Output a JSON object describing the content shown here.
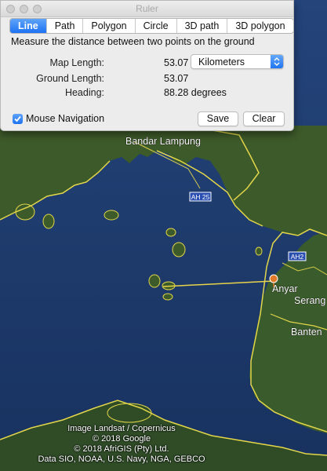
{
  "window": {
    "title": "Ruler"
  },
  "tabs": [
    {
      "label": "Line",
      "active": true
    },
    {
      "label": "Path"
    },
    {
      "label": "Polygon"
    },
    {
      "label": "Circle"
    },
    {
      "label": "3D path"
    },
    {
      "label": "3D polygon"
    }
  ],
  "description": "Measure the distance between two points on the ground",
  "measurements": {
    "map_length_label": "Map Length:",
    "map_length_value": "53.07",
    "ground_length_label": "Ground Length:",
    "ground_length_value": "53.07",
    "heading_label": "Heading:",
    "heading_value": "88.28 degrees"
  },
  "unit_select": {
    "selected": "Kilometers"
  },
  "mouse_navigation": {
    "label": "Mouse Navigation",
    "checked": true
  },
  "buttons": {
    "save": "Save",
    "clear": "Clear"
  },
  "map": {
    "labels": {
      "bandar_lampung": "Bandar Lampung",
      "anyar": "Anyar",
      "serang": "Serang",
      "banten": "Banten"
    },
    "road_shields": {
      "ah25": "AH 25",
      "ah2": "AH2"
    },
    "attribution": {
      "line1": "Image Landsat / Copernicus",
      "line2": "© 2018 Google",
      "line3": "© 2018 AfriGIS (Pty) Ltd.",
      "line4": "Data SIO, NOAA, U.S. Navy, NGA, GEBCO"
    },
    "colors": {
      "sea": "#1b3a6e",
      "land": "#3b5a2c",
      "border": "#e2d64a",
      "ruler_line": "#e8d44a",
      "placemark": "#e07a2a"
    }
  }
}
